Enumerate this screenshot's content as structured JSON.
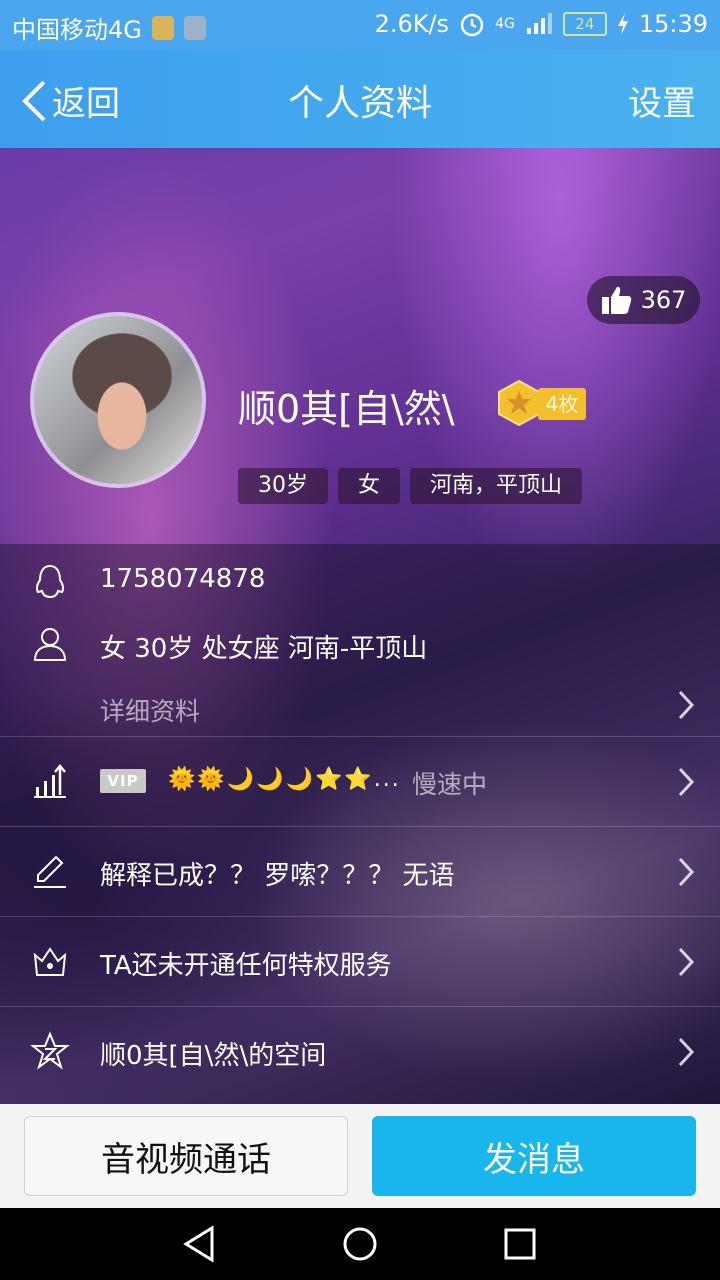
{
  "status_bar": {
    "carrier": "中国移动4G",
    "net_speed": "2.6K/s",
    "network_type": "4G",
    "battery": "24",
    "time": "15:39"
  },
  "header": {
    "back_label": "返回",
    "title": "个人资料",
    "settings_label": "设置"
  },
  "profile": {
    "likes": "367",
    "nickname": "顺0其[自\\然\\",
    "medal_count": "4枚",
    "tags": [
      "30岁",
      "女",
      "河南，平顶山"
    ]
  },
  "info": {
    "qq_number": "1758074878",
    "basic": "女  30岁  处女座  河南-平顶山",
    "detail_label": "详细资料",
    "vip_label": "VIP",
    "vip_icons": "🌞🌞🌙🌙🌙⭐⭐...",
    "vip_speed": "慢速中",
    "signature": "解释已成？？ 罗嗦？？？ 无语",
    "privilege": "TA还未开通任何特权服务",
    "space": "顺0其[自\\然\\的空间"
  },
  "actions": {
    "call_label": "音视频通话",
    "message_label": "发消息"
  },
  "colors": {
    "header_bg": "#4aa6ee",
    "message_button": "#19b6ee",
    "medal": "#f4bf2d"
  }
}
